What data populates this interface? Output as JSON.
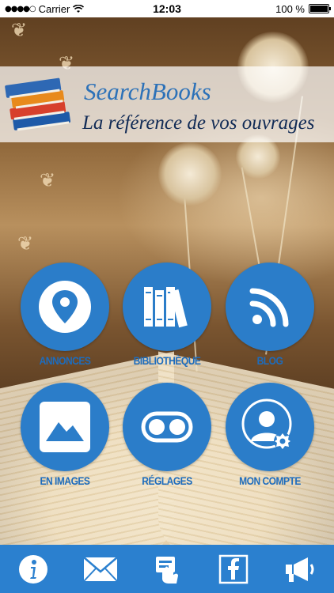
{
  "status_bar": {
    "carrier": "Carrier",
    "time": "12:03",
    "battery": "100 %",
    "battery_level": 1.0
  },
  "header": {
    "title": "SearchBooks",
    "tagline": "La référence de vos ouvrages"
  },
  "menu": {
    "items": [
      {
        "label": "ANNONCES",
        "icon": "map-pin-icon"
      },
      {
        "label": "BIBLIOTHÈQUE",
        "icon": "bookshelf-icon"
      },
      {
        "label": "BLOG",
        "icon": "rss-icon"
      },
      {
        "label": "EN IMAGES",
        "icon": "picture-icon"
      },
      {
        "label": "RÉGLAGES",
        "icon": "toggle-icon"
      },
      {
        "label": "MON COMPTE",
        "icon": "user-settings-icon"
      }
    ]
  },
  "tabbar": {
    "items": [
      {
        "icon": "info-icon"
      },
      {
        "icon": "mail-icon"
      },
      {
        "icon": "contact-card-icon"
      },
      {
        "icon": "facebook-icon"
      },
      {
        "icon": "megaphone-icon"
      }
    ]
  },
  "colors": {
    "accent": "#2b7dc9",
    "label": "#1d6cbd",
    "tabbar": "#2b80cf",
    "brand_title": "#2c71b8",
    "tagline": "#102a55"
  }
}
